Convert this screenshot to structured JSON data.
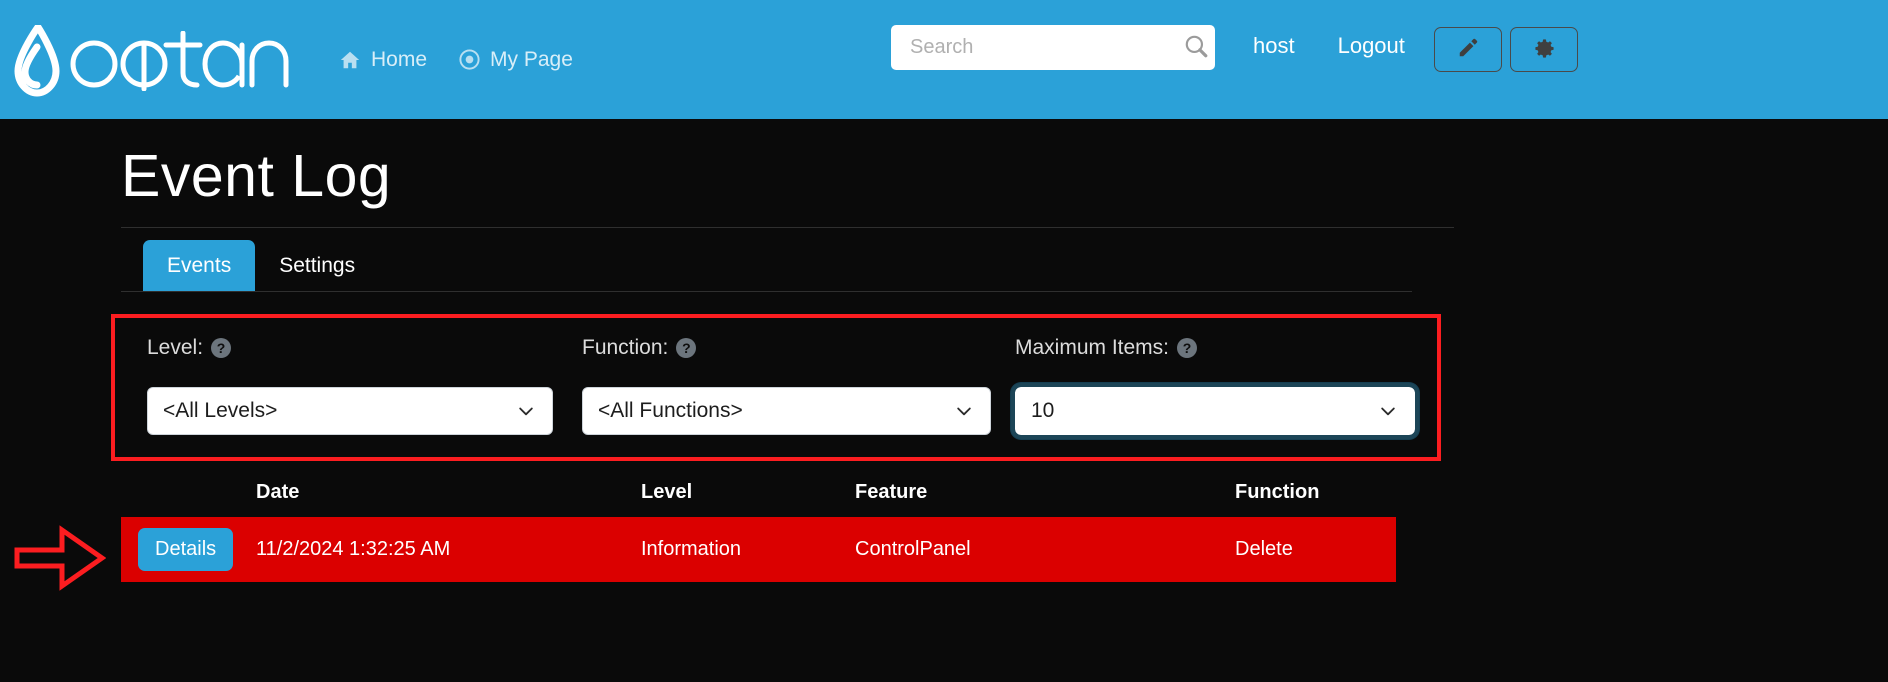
{
  "header": {
    "logo_text": "oqtane",
    "nav": [
      {
        "label": "Home",
        "icon": "home-icon"
      },
      {
        "label": "My Page",
        "icon": "target-icon"
      }
    ],
    "search": {
      "placeholder": "Search",
      "value": "",
      "icon": "search-icon"
    },
    "user": "host",
    "logout": "Logout",
    "edit_button_icon": "pencil-icon",
    "settings_button_icon": "gear-icon",
    "brand_color": "#2ba1d8"
  },
  "page": {
    "title": "Event Log"
  },
  "tabs": [
    {
      "label": "Events",
      "active": true
    },
    {
      "label": "Settings",
      "active": false
    }
  ],
  "filters": {
    "level": {
      "label": "Level:",
      "help_icon": "help-circle-icon",
      "value": "<All Levels>"
    },
    "function": {
      "label": "Function:",
      "help_icon": "help-circle-icon",
      "value": "<All Functions>"
    },
    "maximum_items": {
      "label": "Maximum Items:",
      "help_icon": "help-circle-icon",
      "value": "10",
      "focused": true
    },
    "highlight_color": "#fc1d20"
  },
  "table": {
    "columns": [
      "",
      "Date",
      "Level",
      "Feature",
      "Function"
    ],
    "rows": [
      {
        "action_label": "Details",
        "date": "11/2/2024 1:32:25 AM",
        "level": "Information",
        "feature": "ControlPanel",
        "function": "Delete",
        "status": "error",
        "row_color": "#db0000"
      }
    ]
  }
}
